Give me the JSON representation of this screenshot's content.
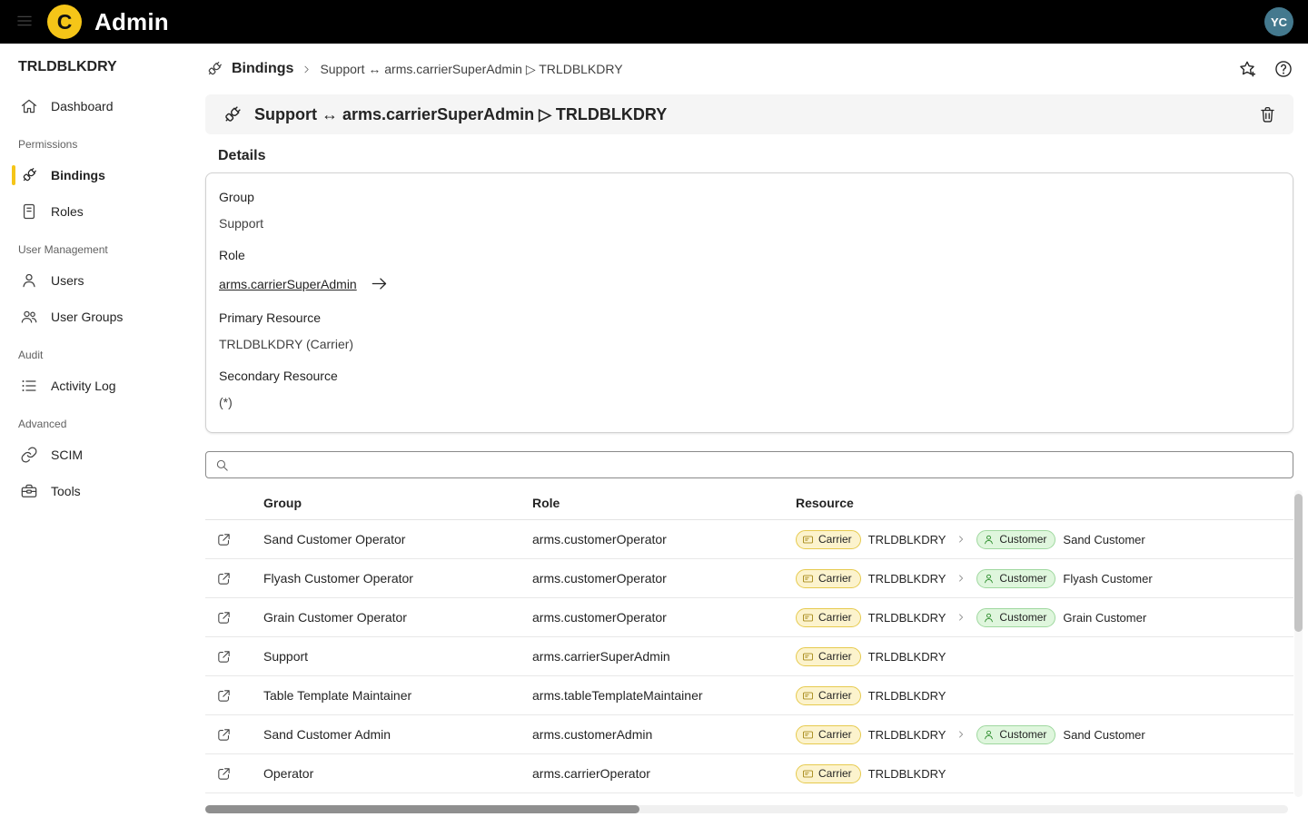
{
  "topbar": {
    "title": "Admin",
    "logo_letter": "C",
    "avatar_initials": "YC"
  },
  "sidebar": {
    "title": "TRLDBLKDRY",
    "sections": [
      {
        "label": null,
        "items": [
          {
            "icon": "home",
            "label": "Dashboard",
            "selected": false
          }
        ]
      },
      {
        "label": "Permissions",
        "items": [
          {
            "icon": "plug",
            "label": "Bindings",
            "selected": true
          },
          {
            "icon": "notebook",
            "label": "Roles",
            "selected": false
          }
        ]
      },
      {
        "label": "User Management",
        "items": [
          {
            "icon": "person",
            "label": "Users",
            "selected": false
          },
          {
            "icon": "people",
            "label": "User Groups",
            "selected": false
          }
        ]
      },
      {
        "label": "Audit",
        "items": [
          {
            "icon": "tasklist",
            "label": "Activity Log",
            "selected": false
          }
        ]
      },
      {
        "label": "Advanced",
        "items": [
          {
            "icon": "link",
            "label": "SCIM",
            "selected": false
          },
          {
            "icon": "toolbox",
            "label": "Tools",
            "selected": false
          }
        ]
      }
    ]
  },
  "breadcrumb": {
    "root": "Bindings",
    "current": "Support ↔ arms.carrierSuperAdmin ▷ TRLDBLKDRY"
  },
  "page_header": {
    "title": "Support ↔ arms.carrierSuperAdmin ▷ TRLDBLKDRY"
  },
  "details": {
    "title": "Details",
    "fields": [
      {
        "label": "Group",
        "value": "Support",
        "type": "text"
      },
      {
        "label": "Role",
        "value": "arms.carrierSuperAdmin",
        "type": "link"
      },
      {
        "label": "Primary Resource",
        "value": "TRLDBLKDRY (Carrier)",
        "type": "text"
      },
      {
        "label": "Secondary Resource",
        "value": "(*)",
        "type": "text"
      }
    ]
  },
  "search": {
    "placeholder": ""
  },
  "bindings_table": {
    "columns": [
      "Group",
      "Role",
      "Resource"
    ],
    "rows": [
      {
        "group": "Sand Customer Operator",
        "role": "arms.customerOperator",
        "resources": [
          {
            "type": "carrier",
            "name": "TRLDBLKDRY"
          },
          {
            "type": "customer",
            "name": "Sand Customer"
          }
        ]
      },
      {
        "group": "Flyash Customer Operator",
        "role": "arms.customerOperator",
        "resources": [
          {
            "type": "carrier",
            "name": "TRLDBLKDRY"
          },
          {
            "type": "customer",
            "name": "Flyash Customer"
          }
        ]
      },
      {
        "group": "Grain Customer Operator",
        "role": "arms.customerOperator",
        "resources": [
          {
            "type": "carrier",
            "name": "TRLDBLKDRY"
          },
          {
            "type": "customer",
            "name": "Grain Customer"
          }
        ]
      },
      {
        "group": "Support",
        "role": "arms.carrierSuperAdmin",
        "resources": [
          {
            "type": "carrier",
            "name": "TRLDBLKDRY"
          }
        ]
      },
      {
        "group": "Table Template Maintainer",
        "role": "arms.tableTemplateMaintainer",
        "resources": [
          {
            "type": "carrier",
            "name": "TRLDBLKDRY"
          }
        ]
      },
      {
        "group": "Sand Customer Admin",
        "role": "arms.customerAdmin",
        "resources": [
          {
            "type": "carrier",
            "name": "TRLDBLKDRY"
          },
          {
            "type": "customer",
            "name": "Sand Customer"
          }
        ]
      },
      {
        "group": "Operator",
        "role": "arms.carrierOperator",
        "resources": [
          {
            "type": "carrier",
            "name": "TRLDBLKDRY"
          }
        ]
      }
    ]
  },
  "badges": {
    "carrier": {
      "label": "Carrier",
      "bg": "#fcf3cd",
      "border": "#e6ca4e",
      "icon_color": "#9a7b00",
      "icon": "card"
    },
    "customer": {
      "label": "Customer",
      "bg": "#dff6dd",
      "border": "#9fd89f",
      "icon_color": "#107c10",
      "icon": "person"
    }
  },
  "colors": {
    "accent": "#f5c518",
    "topbar_bg": "#000000",
    "avatar_bg": "#44798e"
  }
}
